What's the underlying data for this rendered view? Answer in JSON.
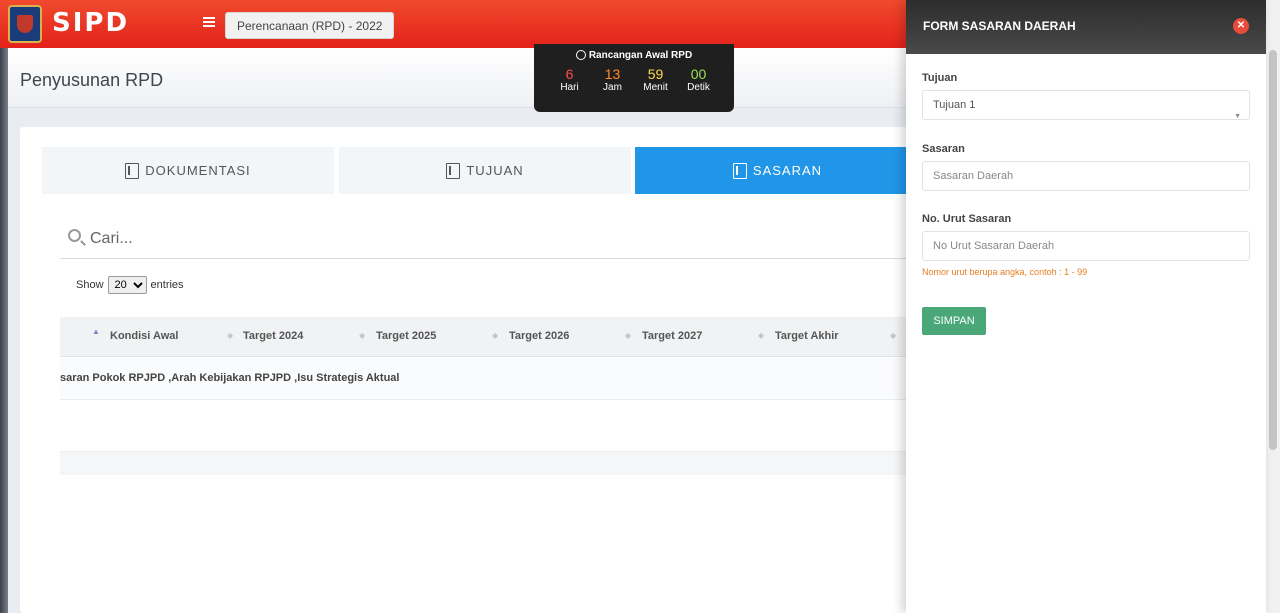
{
  "header": {
    "brand": "SIPD",
    "year_button": "Perencanaan (RPD) - 2022"
  },
  "page": {
    "title": "Penyusunan RPD"
  },
  "countdown": {
    "title": "Rancangan Awal RPD",
    "units": [
      {
        "value": "6",
        "label": "Hari",
        "color": "#ff4d4d"
      },
      {
        "value": "13",
        "label": "Jam",
        "color": "#ff8c2a"
      },
      {
        "value": "59",
        "label": "Menit",
        "color": "#ffd84d"
      },
      {
        "value": "00",
        "label": "Detik",
        "color": "#9be05a"
      }
    ]
  },
  "tabs": [
    {
      "label": "DOKUMENTASI",
      "icon": "book-icon"
    },
    {
      "label": "TUJUAN",
      "icon": "book-icon"
    },
    {
      "label": "SASARAN",
      "icon": "book-icon",
      "active": true
    }
  ],
  "search": {
    "placeholder": "Cari..."
  },
  "entries": {
    "show_label": "Show",
    "value": "20",
    "entries_label": "entries"
  },
  "table": {
    "columns": [
      "Kondisi Awal",
      "Target 2024",
      "Target 2025",
      "Target 2026",
      "Target 2027",
      "Target Akhir"
    ],
    "row_text": "saran Pokok RPJPD ,Arah Kebijakan RPJPD ,Isu Strategis Aktual"
  },
  "form": {
    "title": "FORM SASARAN DAERAH",
    "tujuan_label": "Tujuan",
    "tujuan_value": "Tujuan 1",
    "sasaran_label": "Sasaran",
    "sasaran_placeholder": "Sasaran Daerah",
    "no_urut_label": "No. Urut Sasaran",
    "no_urut_placeholder": "No Urut Sasaran Daerah",
    "hint": "Nomor urut berupa angka, contoh : 1 - 99",
    "save_label": "SIMPAN"
  }
}
